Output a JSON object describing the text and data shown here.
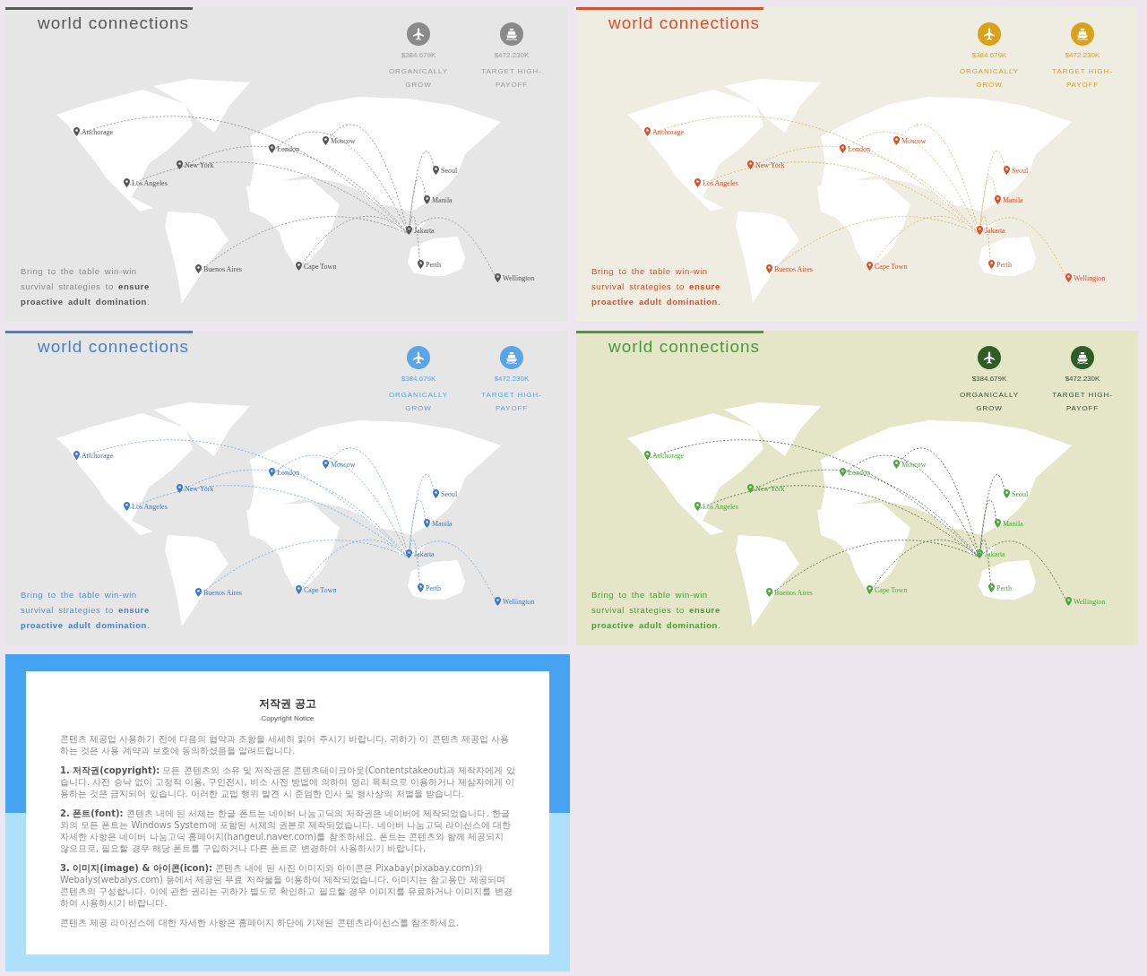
{
  "slides": [
    {
      "kind": "map",
      "color": "#595959",
      "title": "world connections",
      "stats": [
        {
          "value": "$384.679K",
          "label": "ORGANICALLY GROW"
        },
        {
          "value": "$472.230K",
          "label": "TARGET HIGH-PAYOFF"
        }
      ],
      "cities": [
        "Anchorage",
        "Moscow",
        "London",
        "New York",
        "Los Angeles",
        "Seoul",
        "Manila",
        "Jakarta",
        "Buenos Aires",
        "Cape Town",
        "Perth",
        "Wellington"
      ],
      "description": "Bring to the table win-win survival strategies to **ensure proactive adult domination**."
    },
    {
      "kind": "map",
      "color": "#d9502c",
      "title": "world connections",
      "stats": [
        {
          "value": "$384.679K",
          "label": "ORGANICALLY GROW"
        },
        {
          "value": "$472.230K",
          "label": "TARGET HIGH-PAYOFF"
        }
      ],
      "cities": [
        "Anchorage",
        "Moscow",
        "London",
        "New York",
        "Los Angeles",
        "Seoul",
        "Manila",
        "Jakarta",
        "Buenos Aires",
        "Cape Town",
        "Perth",
        "Wellington"
      ],
      "description": "Bring to the table win-win survival strategies to **ensure proactive adult domination**."
    },
    {
      "kind": "map",
      "color": "#4a7fc4",
      "title": "world connections",
      "stats": [
        {
          "value": "$384.679K",
          "label": "ORGANICALLY GROW"
        },
        {
          "value": "$472.230K",
          "label": "TARGET HIGH-PAYOFF"
        }
      ],
      "cities": [
        "Anchorage",
        "Moscow",
        "London",
        "New York",
        "Los Angeles",
        "Seoul",
        "Manila",
        "Jakarta",
        "Buenos Aires",
        "Cape Town",
        "Perth",
        "Wellington"
      ],
      "description": "Bring to the table win-win survival strategies to **ensure proactive adult domination**."
    },
    {
      "kind": "map",
      "color": "#4a9a3c",
      "title": "world connections",
      "stats": [
        {
          "value": "$384.679K",
          "label": "ORGANICALLY GROW"
        },
        {
          "value": "$472.230K",
          "label": "TARGET HIGH-PAYOFF"
        }
      ],
      "cities": [
        "Anchorage",
        "Moscow",
        "London",
        "New York",
        "Los Angeles",
        "Seoul",
        "Manila",
        "Jakarta",
        "Buenos Aires",
        "Cape Town",
        "Perth",
        "Wellington"
      ],
      "description": "Bring to the table win-win survival strategies to **ensure proactive adult domination**."
    },
    {
      "kind": "notice",
      "title": "저작권 공고",
      "subtitle": "Copyright Notice",
      "paragraphs": [
        "콘텐츠 제공업 사용하기 전에 다음의 협약과 조항을 세세히 읽어 주시기 바랍니다. 귀하가 이 콘텐츠 제공업 사용하는 것은 사용 계약과 보호에 동의하셨음을 알려드립니다.",
        "**1. 저작권(copyright):** 모든 콘텐츠의 소유 및 저작권은 콘텐츠테이크아웃(Contentstakeout)과 제작자에게 있습니다. 사전 승낙 없이 고정적 이용, 구인전시, 비소 사전 방법에 의하여 영리 목적으로 이용하거나 제삼자에게 이용하는 것은 금지되어 있습니다. 이러한 교법 행위 발견 시 준엄한 민사 및 형사상의 처벌을 받습니다.",
        "**2. 폰트(font):** 콘텐츠 내에 된 서체는 한글 폰트는 네이버 나눔고딕의 저작권은 네이버에 제작되었습니다. 한글 외의 모든 폰트는 Windows System에 포함된 서체의 권본로 제작되었습니다. 네이버 나눔고딕 라이선스에 대한 자세한 사항은 네이버 나눔고딕 홈페이지(hangeul.naver.com)를 참조하세요. 폰트는 콘텐츠와 함께 제공되지 않으므로, 필요할 경우 해당 폰트를 구입하거나 다른 폰트로 변경하여 사용하시기 바랍니다.",
        "**3. 이미지(image) & 아이콘(icon):** 콘텐츠 내에 된 사진 이미지와 아이콘은 Pixabay(pixabay.com)와 Webalys(webalys.com) 등에서 제공된 무료 저작물을 이용하여 제작되었습니다. 이미지는 참고용만 제공되며 콘텐츠의 구성합니다. 이에 관한 권리는 귀하가 별도로 확인하고 필요할 경우 이미지를 유료하거나 이미지를 변경하여 사용하시기 바랍니다.",
        "콘텐츠 제공 라이선스에 대한 자세한 사항은 홈페이지 하단에 기재된 콘텐츠라이선스를 참조하세요."
      ]
    }
  ]
}
